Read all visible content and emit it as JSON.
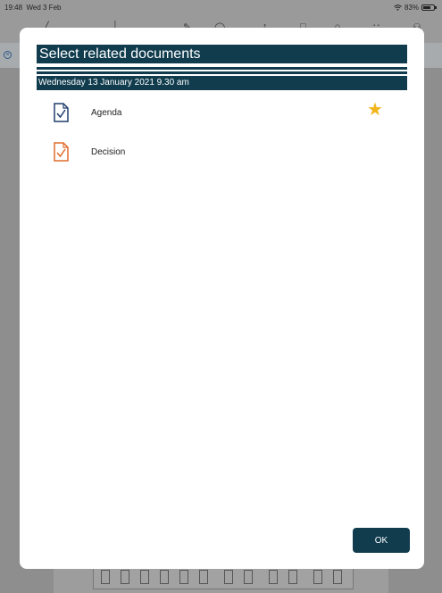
{
  "status_bar": {
    "time": "19:48",
    "date": "Wed 3 Feb",
    "battery": "83%"
  },
  "dialog": {
    "title": "Select related documents",
    "meeting_date": "Wednesday 13 January 2021 9.30 am",
    "documents": [
      {
        "label": "Agenda",
        "icon": "document-check-icon",
        "color": "#1f3f6e",
        "starred": true
      },
      {
        "label": "Decision",
        "icon": "document-check-icon",
        "color": "#e06a2a",
        "starred": false
      }
    ],
    "ok_label": "OK"
  },
  "colors": {
    "primary": "#103c4e",
    "star": "#f2b51c",
    "backdrop": "#8e8e8e"
  }
}
